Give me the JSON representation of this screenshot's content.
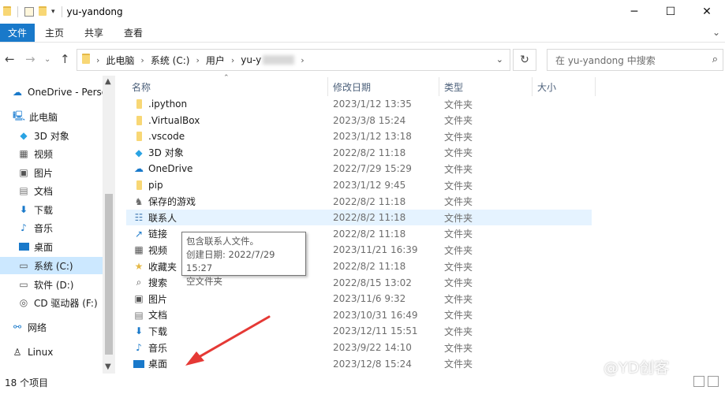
{
  "window": {
    "title": "yu-yandong"
  },
  "ribbon": {
    "tabs": [
      "文件",
      "主页",
      "共享",
      "查看"
    ]
  },
  "address": {
    "crumbs": [
      "此电脑",
      "系统 (C:)",
      "用户",
      "yu-y"
    ],
    "search_placeholder": "在 yu-yandong 中搜索"
  },
  "nav": {
    "items": [
      {
        "label": "OneDrive - Perso",
        "icon": "cloud-icon"
      },
      {
        "label": "此电脑",
        "icon": "computer-icon"
      },
      {
        "label": "3D 对象",
        "icon": "cube-icon"
      },
      {
        "label": "视频",
        "icon": "video-icon"
      },
      {
        "label": "图片",
        "icon": "picture-icon"
      },
      {
        "label": "文档",
        "icon": "document-icon"
      },
      {
        "label": "下载",
        "icon": "download-icon"
      },
      {
        "label": "音乐",
        "icon": "music-icon"
      },
      {
        "label": "桌面",
        "icon": "desktop-icon"
      },
      {
        "label": "系统 (C:)",
        "icon": "drive-icon"
      },
      {
        "label": "软件 (D:)",
        "icon": "drive-icon"
      },
      {
        "label": "CD 驱动器 (F:)",
        "icon": "cd-drive-icon"
      },
      {
        "label": "网络",
        "icon": "network-icon"
      },
      {
        "label": "Linux",
        "icon": "linux-icon"
      }
    ]
  },
  "columns": {
    "name": "名称",
    "date": "修改日期",
    "type": "类型",
    "size": "大小"
  },
  "files": [
    {
      "name": ".ipython",
      "date": "2023/1/12 13:35",
      "type": "文件夹",
      "icon": "folder-icon"
    },
    {
      "name": ".VirtualBox",
      "date": "2023/3/8 15:24",
      "type": "文件夹",
      "icon": "folder-icon"
    },
    {
      "name": ".vscode",
      "date": "2023/1/12 13:18",
      "type": "文件夹",
      "icon": "folder-icon"
    },
    {
      "name": "3D 对象",
      "date": "2022/8/2 11:18",
      "type": "文件夹",
      "icon": "cube-icon"
    },
    {
      "name": "OneDrive",
      "date": "2022/7/29 15:29",
      "type": "文件夹",
      "icon": "cloud-icon"
    },
    {
      "name": "pip",
      "date": "2023/1/12 9:45",
      "type": "文件夹",
      "icon": "folder-icon"
    },
    {
      "name": "保存的游戏",
      "date": "2022/8/2 11:18",
      "type": "文件夹",
      "icon": "saved-games-icon"
    },
    {
      "name": "联系人",
      "date": "2022/8/2 11:18",
      "type": "文件夹",
      "icon": "contacts-icon"
    },
    {
      "name": "链接",
      "date": "2022/8/2 11:18",
      "type": "文件夹",
      "icon": "links-icon"
    },
    {
      "name": "视频",
      "date": "2023/11/21 16:39",
      "type": "文件夹",
      "icon": "video-icon"
    },
    {
      "name": "收藏夹",
      "date": "2022/8/2 11:18",
      "type": "文件夹",
      "icon": "favorites-icon"
    },
    {
      "name": "搜索",
      "date": "2022/8/15 13:02",
      "type": "文件夹",
      "icon": "search-folder-icon"
    },
    {
      "name": "图片",
      "date": "2023/11/6 9:32",
      "type": "文件夹",
      "icon": "picture-icon"
    },
    {
      "name": "文档",
      "date": "2023/10/31 16:49",
      "type": "文件夹",
      "icon": "document-icon"
    },
    {
      "name": "下载",
      "date": "2023/12/11 15:51",
      "type": "文件夹",
      "icon": "download-icon"
    },
    {
      "name": "音乐",
      "date": "2023/9/22 14:10",
      "type": "文件夹",
      "icon": "music-icon"
    },
    {
      "name": "桌面",
      "date": "2023/12/8 15:24",
      "type": "文件夹",
      "icon": "desktop-icon"
    }
  ],
  "tooltip": {
    "line1": "包含联系人文件。",
    "line2": "创建日期: 2022/7/29 15:27",
    "line3": "空文件夹"
  },
  "status": {
    "count": "18 个项目"
  },
  "watermark": "@YD创客",
  "colors": {
    "accent": "#1979ca",
    "selected": "#cce8ff",
    "hover": "#e5f3ff",
    "arrow": "#e53935"
  }
}
